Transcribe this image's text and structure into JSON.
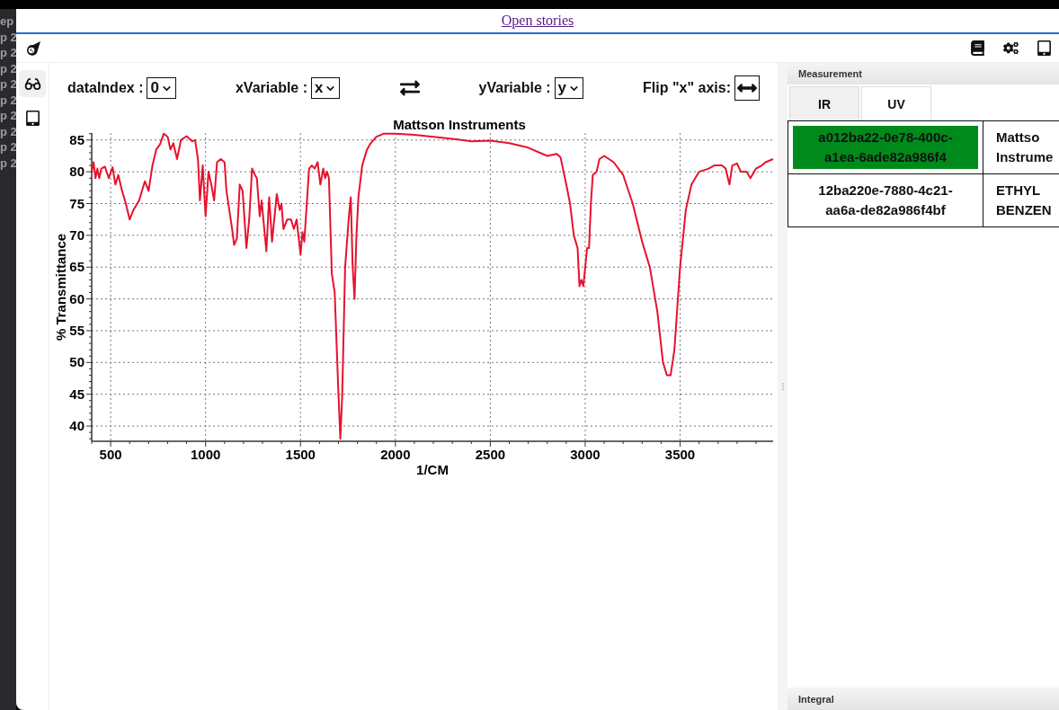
{
  "background_window": {
    "lines": [
      "ep",
      "p 2",
      "p 2",
      "p 2",
      "p 2",
      "p 2",
      "p 2",
      "p 2",
      "p 2",
      "p 2"
    ]
  },
  "top_link": "Open stories",
  "sidebar": {
    "items": [
      {
        "kind": "glasses",
        "selected": true
      },
      {
        "kind": "tablet",
        "selected": false
      }
    ]
  },
  "controls": [
    {
      "kind": "select",
      "label": "dataIndex :",
      "value": "0"
    },
    {
      "kind": "select",
      "label": "xVariable :",
      "value": "x"
    },
    {
      "kind": "swap"
    },
    {
      "kind": "select",
      "label": "yVariable :",
      "value": "y"
    },
    {
      "kind": "flip",
      "label": "Flip \"x\" axis:"
    }
  ],
  "chart_data": {
    "type": "line",
    "grid": true,
    "title": "Mattson Instruments",
    "xlabel": "1/CM",
    "ylabel": "% Transmittance",
    "xlim": [
      400,
      3990
    ],
    "ylim": [
      37.6,
      86.1
    ],
    "xticks": [
      500,
      1000,
      1500,
      2000,
      2500,
      3000,
      3500
    ],
    "yticks": [
      40,
      45,
      50,
      55,
      60,
      65,
      70,
      75,
      80,
      85
    ],
    "x": [
      400,
      410,
      420,
      430,
      440,
      450,
      470,
      490,
      510,
      525,
      540,
      560,
      580,
      600,
      620,
      650,
      680,
      700,
      720,
      740,
      760,
      780,
      800,
      815,
      830,
      850,
      870,
      900,
      930,
      945,
      960,
      970,
      985,
      1000,
      1015,
      1030,
      1045,
      1060,
      1080,
      1100,
      1110,
      1140,
      1150,
      1165,
      1180,
      1195,
      1215,
      1230,
      1245,
      1260,
      1270,
      1285,
      1295,
      1320,
      1335,
      1350,
      1375,
      1390,
      1400,
      1410,
      1430,
      1450,
      1465,
      1480,
      1500,
      1510,
      1520,
      1545,
      1560,
      1575,
      1590,
      1605,
      1620,
      1630,
      1640,
      1650,
      1665,
      1680,
      1700,
      1710,
      1720,
      1735,
      1755,
      1765,
      1775,
      1785,
      1795,
      1805,
      1825,
      1850,
      1870,
      1900,
      1940,
      2000,
      2100,
      2200,
      2300,
      2400,
      2500,
      2600,
      2700,
      2800,
      2850,
      2870,
      2900,
      2920,
      2940,
      2960,
      2970,
      2980,
      2990,
      3010,
      3020,
      3030,
      3040,
      3060,
      3075,
      3100,
      3150,
      3200,
      3250,
      3300,
      3340,
      3380,
      3410,
      3430,
      3450,
      3470,
      3500,
      3530,
      3560,
      3600,
      3650,
      3680,
      3720,
      3740,
      3760,
      3775,
      3800,
      3820,
      3850,
      3870,
      3900,
      3930,
      3950,
      3990
    ],
    "series": [
      {
        "color": "#e8112d",
        "values": [
          80,
          81.5,
          79,
          80.5,
          79,
          80.5,
          80.8,
          79,
          80.7,
          78,
          79.5,
          77,
          75,
          72.5,
          74,
          75.5,
          78.5,
          77,
          81,
          83.5,
          84.3,
          86,
          85.5,
          83.5,
          84.5,
          82,
          85,
          85.6,
          84.8,
          85,
          82,
          75.5,
          81,
          73,
          80,
          78,
          75.5,
          81.5,
          82,
          81.5,
          77,
          71,
          68.5,
          69.5,
          78,
          77,
          68,
          72.5,
          80.5,
          79.5,
          79,
          73,
          75.5,
          67.5,
          76,
          69,
          76.5,
          74,
          75,
          71,
          72.5,
          72.5,
          71,
          72.5,
          67,
          70.5,
          69,
          80.5,
          81,
          80.5,
          81.5,
          78,
          80.5,
          79,
          80,
          79,
          64,
          61,
          45,
          38,
          45,
          65,
          73,
          76,
          65,
          60,
          70,
          76,
          81,
          83.5,
          84.5,
          85.5,
          86,
          86,
          85.8,
          85.5,
          85.2,
          84.8,
          84.9,
          84.5,
          83.8,
          82.5,
          82.8,
          82.3,
          78,
          75,
          70,
          68,
          62,
          63,
          62,
          68,
          68,
          75,
          79.5,
          80,
          82,
          82.5,
          81.5,
          79.5,
          75,
          69,
          65,
          58,
          50,
          48,
          48,
          52,
          65,
          74,
          78,
          80,
          80.5,
          81,
          81,
          80.5,
          78,
          81,
          81.3,
          80,
          80,
          79,
          80.5,
          81,
          81.5,
          82
        ]
      }
    ]
  },
  "measurement": {
    "title": "Measurement",
    "tabs": [
      {
        "label": "IR",
        "selected": true
      },
      {
        "label": "UV",
        "selected": false
      }
    ],
    "rows": [
      {
        "id": "a012ba22-0e78-400c-a1ea-6ade82a986f4",
        "column_2": [
          "Mattso",
          "Instrume"
        ],
        "selected": true
      },
      {
        "id": "12ba220e-7880-4c21-aa6a-de82a986f4bf",
        "column_2": [
          "ETHYL",
          "BENZEN"
        ],
        "selected": false
      }
    ]
  },
  "integral": {
    "title": "Integral"
  }
}
